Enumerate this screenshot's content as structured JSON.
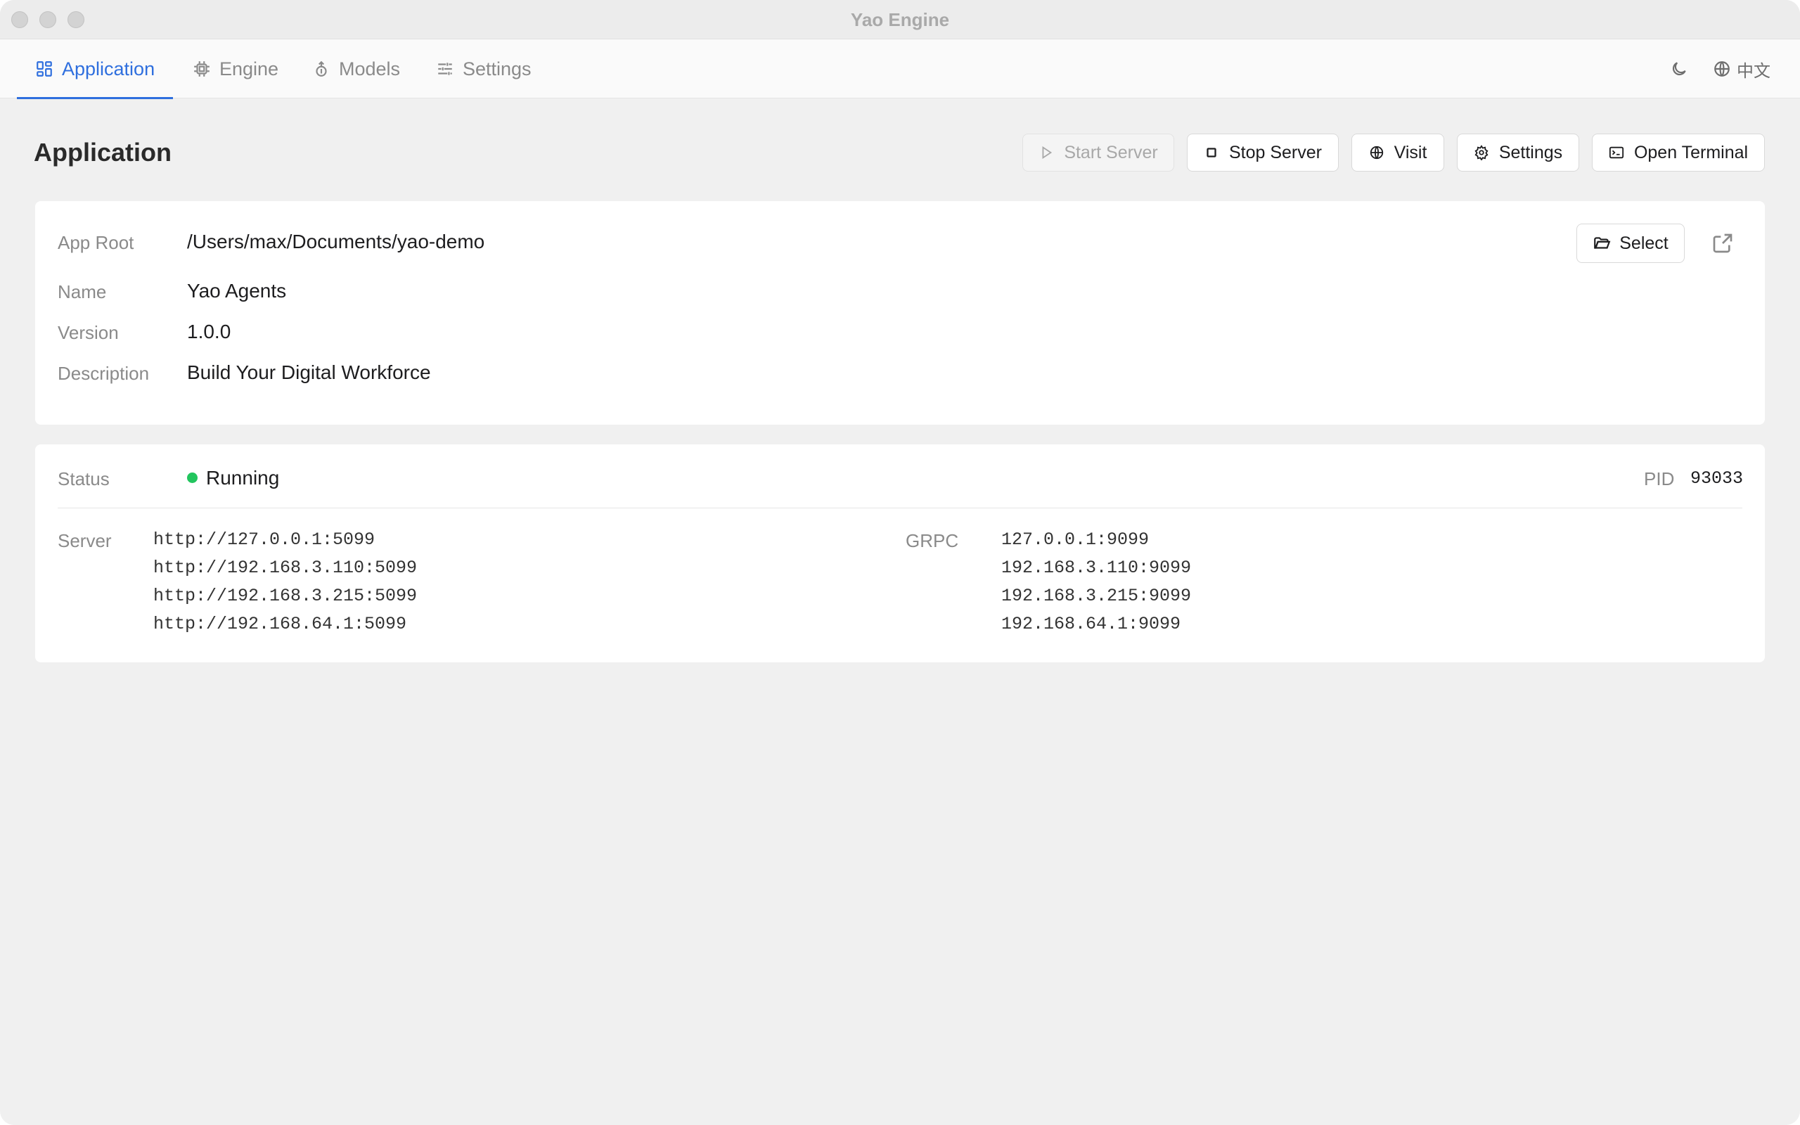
{
  "window": {
    "title": "Yao Engine"
  },
  "tabs": [
    {
      "label": "Application",
      "icon": "dashboard-grid-icon",
      "active": true
    },
    {
      "label": "Engine",
      "icon": "cpu-chip-icon",
      "active": false
    },
    {
      "label": "Models",
      "icon": "model-cube-icon",
      "active": false
    },
    {
      "label": "Settings",
      "icon": "sliders-icon",
      "active": false
    }
  ],
  "toolbar_right": {
    "theme_icon": "moon-icon",
    "language_label": "中文",
    "language_icon": "globe-icon"
  },
  "page": {
    "title": "Application",
    "actions": {
      "start_server": "Start Server",
      "stop_server": "Stop Server",
      "visit": "Visit",
      "settings": "Settings",
      "open_terminal": "Open Terminal"
    }
  },
  "app_info": {
    "app_root_label": "App Root",
    "app_root_value": "/Users/max/Documents/yao-demo",
    "select_label": "Select",
    "name_label": "Name",
    "name_value": "Yao Agents",
    "version_label": "Version",
    "version_value": "1.0.0",
    "description_label": "Description",
    "description_value": "Build Your Digital Workforce"
  },
  "status": {
    "status_label": "Status",
    "status_value": "Running",
    "status_color": "#22c55e",
    "pid_label": "PID",
    "pid_value": "93033",
    "server_label": "Server",
    "server_addresses": [
      "http://127.0.0.1:5099",
      "http://192.168.3.110:5099",
      "http://192.168.3.215:5099",
      "http://192.168.64.1:5099"
    ],
    "grpc_label": "GRPC",
    "grpc_addresses": [
      "127.0.0.1:9099",
      "192.168.3.110:9099",
      "192.168.3.215:9099",
      "192.168.64.1:9099"
    ]
  },
  "colors": {
    "accent": "#2f6fde",
    "running": "#22c55e",
    "background": "#f0f0f0"
  }
}
